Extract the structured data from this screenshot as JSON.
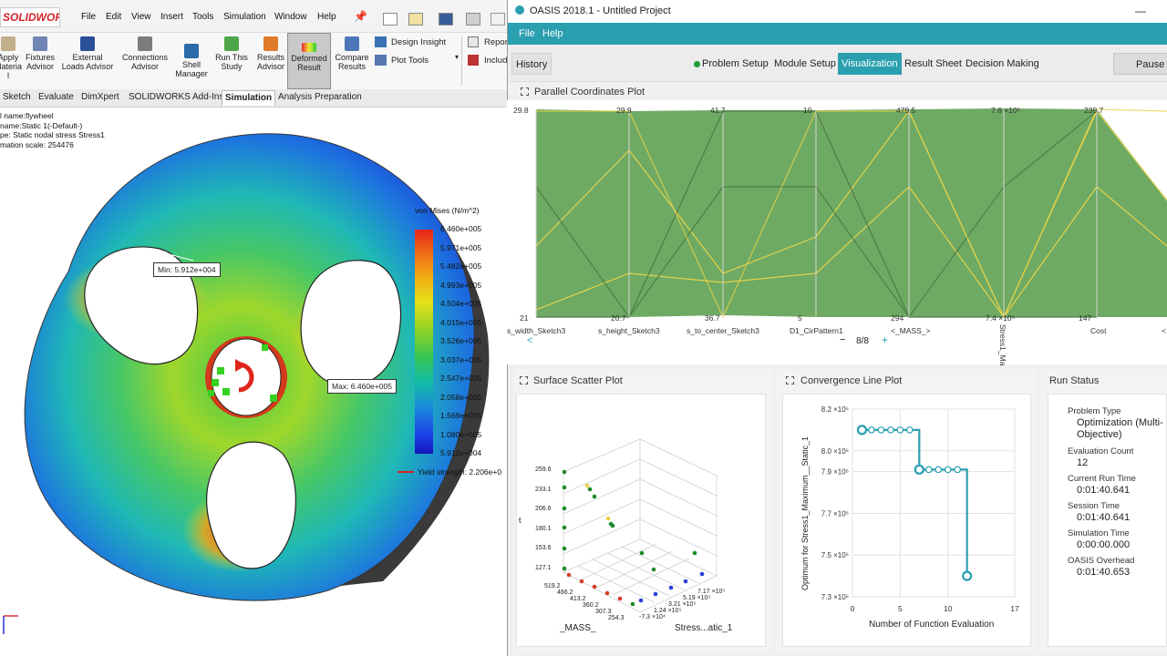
{
  "solidworks": {
    "logo": "SOLIDWORKS",
    "menu": [
      "File",
      "Edit",
      "View",
      "Insert",
      "Tools",
      "Simulation",
      "Window",
      "Help"
    ],
    "ribbon": {
      "apply_material": "Apply Material",
      "fixtures": "Fixtures Advisor",
      "external_loads": "External Loads Advisor",
      "connections": "Connections Advisor",
      "shell_manager": "Shell Manager",
      "run_this_study": "Run This Study",
      "results_advisor": "Results Advisor",
      "deformed_result": "Deformed Result",
      "compare_results": "Compare Results",
      "design_insight": "Design Insight",
      "plot_tools": "Plot Tools",
      "report": "Report",
      "include": "Include"
    },
    "tabs": [
      "Sketch",
      "Evaluate",
      "DimXpert",
      "SOLIDWORKS Add-Ins",
      "Simulation",
      "Analysis Preparation"
    ],
    "active_tab": "Simulation",
    "info": {
      "line1": "l name:flywheel",
      "line2": "name:Static 1(-Default-)",
      "line3": "pe: Static nodal stress Stress1",
      "line4": "mation scale: 254476"
    },
    "legend": {
      "title": "von Mises (N/m^2)",
      "values": [
        "6.460e+005",
        "5.971e+005",
        "5.482e+005",
        "4.993e+005",
        "4.504e+005",
        "4.015e+005",
        "3.526e+005",
        "3.037e+005",
        "2.547e+005",
        "2.058e+005",
        "1.569e+005",
        "1.080e+005",
        "5.912e+004"
      ],
      "yield": "Yield strength: 2.206e+0"
    },
    "probe_min": "Min: 5.912e+004",
    "probe_max": "Max: 6.460e+005",
    "colors": {
      "accent": "#d4222b"
    }
  },
  "oasis": {
    "title": "OASIS 2018.1 - Untitled Project",
    "menu": [
      "File",
      "Help"
    ],
    "history_label": "History",
    "nav": [
      "Problem Setup",
      "Module Setup",
      "Visualization",
      "Result Sheet",
      "Decision Making"
    ],
    "active_nav": "Visualization",
    "pause_label": "Pause",
    "accent": "#2a9fb0",
    "parallel": {
      "title": "Parallel Coordinates Plot",
      "axes": [
        {
          "name": "s_width_Sketch3",
          "top": "29.8",
          "bottom": "21"
        },
        {
          "name": "s_height_Sketch3",
          "top": "29.9",
          "bottom": "20.7"
        },
        {
          "name": "s_to_center_Sketch3",
          "top": "41.7",
          "bottom": "36.7"
        },
        {
          "name": "D1_CirPattern1",
          "top": "10",
          "bottom": "5"
        },
        {
          "name": "<_MASS_>",
          "top": "479.5",
          "bottom": "294"
        },
        {
          "name": "Stress1_Ma",
          "top": "7.6 ×10⁵",
          "bottom": "7.4 ×10⁵"
        },
        {
          "name": "Cost",
          "top": "239.7",
          "bottom": "147"
        },
        {
          "name": "<",
          "top": "",
          "bottom": ""
        }
      ],
      "pager": "8/8"
    },
    "scatter": {
      "title": "Surface Scatter Plot",
      "z_ticks": [
        "259.6",
        "233.1",
        "206.6",
        "180.1",
        "153.6",
        "127.1"
      ],
      "mass_ticks": [
        "519.2",
        "466.2",
        "413.2",
        "360.2",
        "307.3",
        "254.3"
      ],
      "stress_ticks": [
        "7.17 ×10⁵",
        "5.19 ×10⁵",
        "3.21 ×10⁵",
        "1.24 ×10⁵",
        "-7.3 ×10⁴"
      ],
      "xlabel": "_MASS_",
      "ylabel": "Stress...atic_1",
      "zlabel": "t"
    },
    "convergence": {
      "title": "Convergence Line Plot",
      "ylabel": "Optimum for Stress1_Maximum__Static_1",
      "xlabel": "Number of Function Evaluation",
      "y_ticks": [
        "8.2 ×10⁵",
        "8.0 ×10⁵",
        "7.9 ×10⁵",
        "7.7 ×10⁵",
        "7.5 ×10⁵",
        "7.3 ×10⁵"
      ],
      "x_ticks": [
        "0",
        "5",
        "10",
        "17"
      ]
    },
    "run_status": {
      "title": "Run Status",
      "problem_type_label": "Problem Type",
      "problem_type_value": "Optimization (Multi-Objective)",
      "eval_count_label": "Evaluation Count",
      "eval_count_value": "12",
      "current_run_label": "Current Run Time",
      "current_run_value": "0:01:40.641",
      "session_label": "Session Time",
      "session_value": "0:01:40.641",
      "simulation_label": "Simulation Time",
      "simulation_value": "0:00:00.000",
      "overhead_label": "OASIS Overhead",
      "overhead_value": "0:01:40.653"
    }
  },
  "chart_data": [
    {
      "type": "line",
      "title": "Convergence Line Plot",
      "xlabel": "Number of Function Evaluation",
      "ylabel": "Optimum for Stress1_Maximum__Static_1",
      "xlim": [
        0,
        17
      ],
      "ylim": [
        730000,
        820000
      ],
      "x": [
        1,
        2,
        3,
        4,
        5,
        6,
        7,
        8,
        9,
        10,
        11,
        12
      ],
      "values": [
        810000,
        810000,
        810000,
        810000,
        810000,
        810000,
        791000,
        791000,
        791000,
        791000,
        791000,
        740000
      ]
    },
    {
      "type": "line",
      "title": "Parallel Coordinates Plot",
      "categories": [
        "s_width_Sketch3",
        "s_height_Sketch3",
        "s_to_center_Sketch3",
        "D1_CirPattern1",
        "<_MASS_>",
        "Stress1_Ma",
        "Cost"
      ],
      "ranges": [
        [
          21,
          29.8
        ],
        [
          20.7,
          29.9
        ],
        [
          36.7,
          41.7
        ],
        [
          5,
          10
        ],
        [
          294,
          479.5
        ],
        [
          740000,
          760000
        ],
        [
          147,
          239.7
        ]
      ]
    }
  ]
}
